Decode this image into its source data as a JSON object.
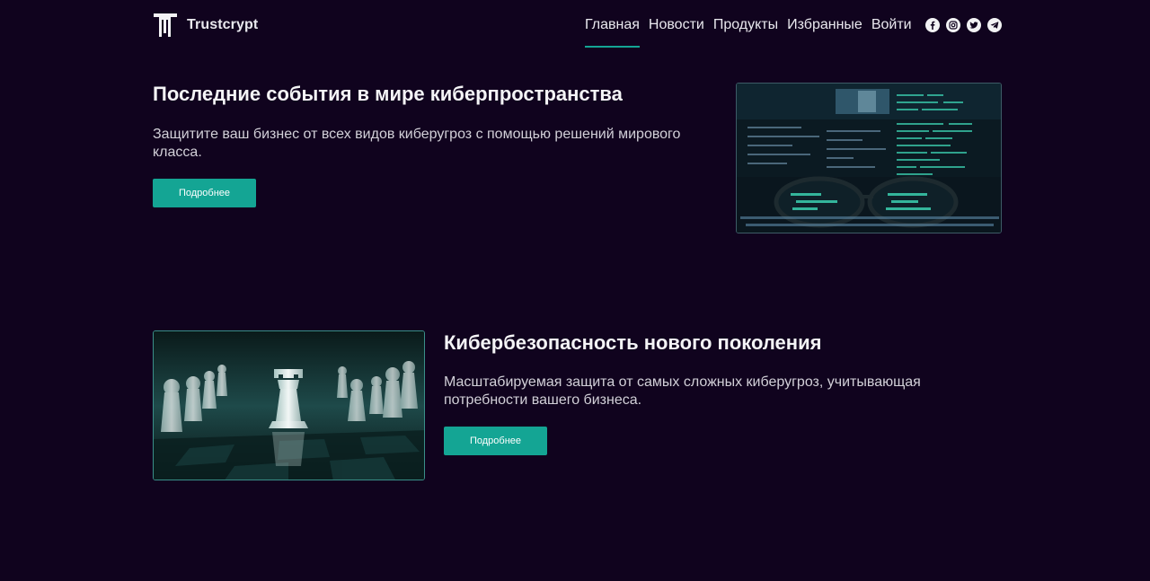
{
  "brand": {
    "name": "Trustcrypt"
  },
  "nav": {
    "items": [
      {
        "label": "Главная",
        "active": true
      },
      {
        "label": "Новости",
        "active": false
      },
      {
        "label": "Продукты",
        "active": false
      },
      {
        "label": "Избранные",
        "active": false
      },
      {
        "label": "Войти",
        "active": false
      }
    ]
  },
  "socials": [
    "facebook-icon",
    "instagram-icon",
    "twitter-icon",
    "telegram-icon"
  ],
  "section1": {
    "title": "Последние события в мире киберпространства",
    "text": "Защитите ваш бизнес от всех видов киберугроз с помощью решений мирового класса.",
    "button": "Подробнее"
  },
  "section2": {
    "title": "Кибербезопасность нового поколения",
    "text": "Масштабируемая защита от самых сложных киберугроз, учитывающая потребности вашего бизнеса.",
    "button": "Подробнее"
  },
  "colors": {
    "background": "#10031e",
    "accent": "#14a594",
    "text": "#e9e9ee"
  }
}
